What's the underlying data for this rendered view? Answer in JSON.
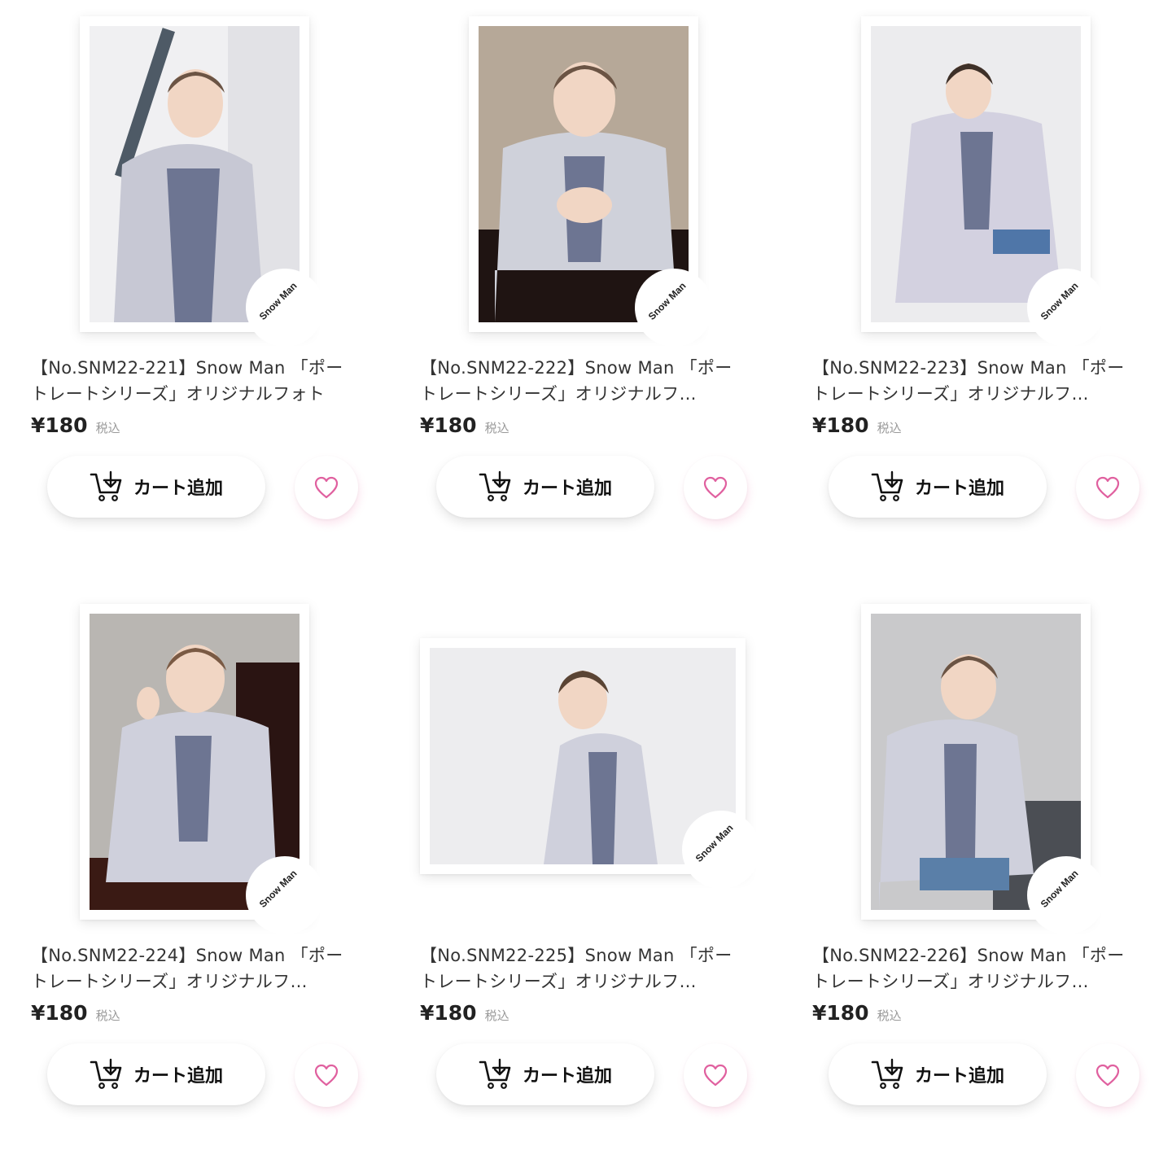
{
  "products": [
    {
      "title": "【No.SNM22-221】Snow Man 「ポートレートシリーズ」オリジナルフォト",
      "price": "¥180",
      "tax": "税込",
      "cart_label": "カート追加",
      "watermark": "Snow Man"
    },
    {
      "title": "【No.SNM22-222】Snow Man 「ポートレートシリーズ」オリジナルフ…",
      "price": "¥180",
      "tax": "税込",
      "cart_label": "カート追加",
      "watermark": "Snow Man"
    },
    {
      "title": "【No.SNM22-223】Snow Man 「ポートレートシリーズ」オリジナルフ…",
      "price": "¥180",
      "tax": "税込",
      "cart_label": "カート追加",
      "watermark": "Snow Man"
    },
    {
      "title": "【No.SNM22-224】Snow Man 「ポートレートシリーズ」オリジナルフ…",
      "price": "¥180",
      "tax": "税込",
      "cart_label": "カート追加",
      "watermark": "Snow Man"
    },
    {
      "title": "【No.SNM22-225】Snow Man 「ポートレートシリーズ」オリジナルフ…",
      "price": "¥180",
      "tax": "税込",
      "cart_label": "カート追加",
      "watermark": "Snow Man"
    },
    {
      "title": "【No.SNM22-226】Snow Man 「ポートレートシリーズ」オリジナルフ…",
      "price": "¥180",
      "tax": "税込",
      "cart_label": "カート追加",
      "watermark": "Snow Man"
    }
  ],
  "icons": {
    "cart": "cart-add-icon",
    "favorite": "heart-icon"
  },
  "colors": {
    "heart": "#e0609f",
    "price": "#222222",
    "tax": "#999999"
  }
}
